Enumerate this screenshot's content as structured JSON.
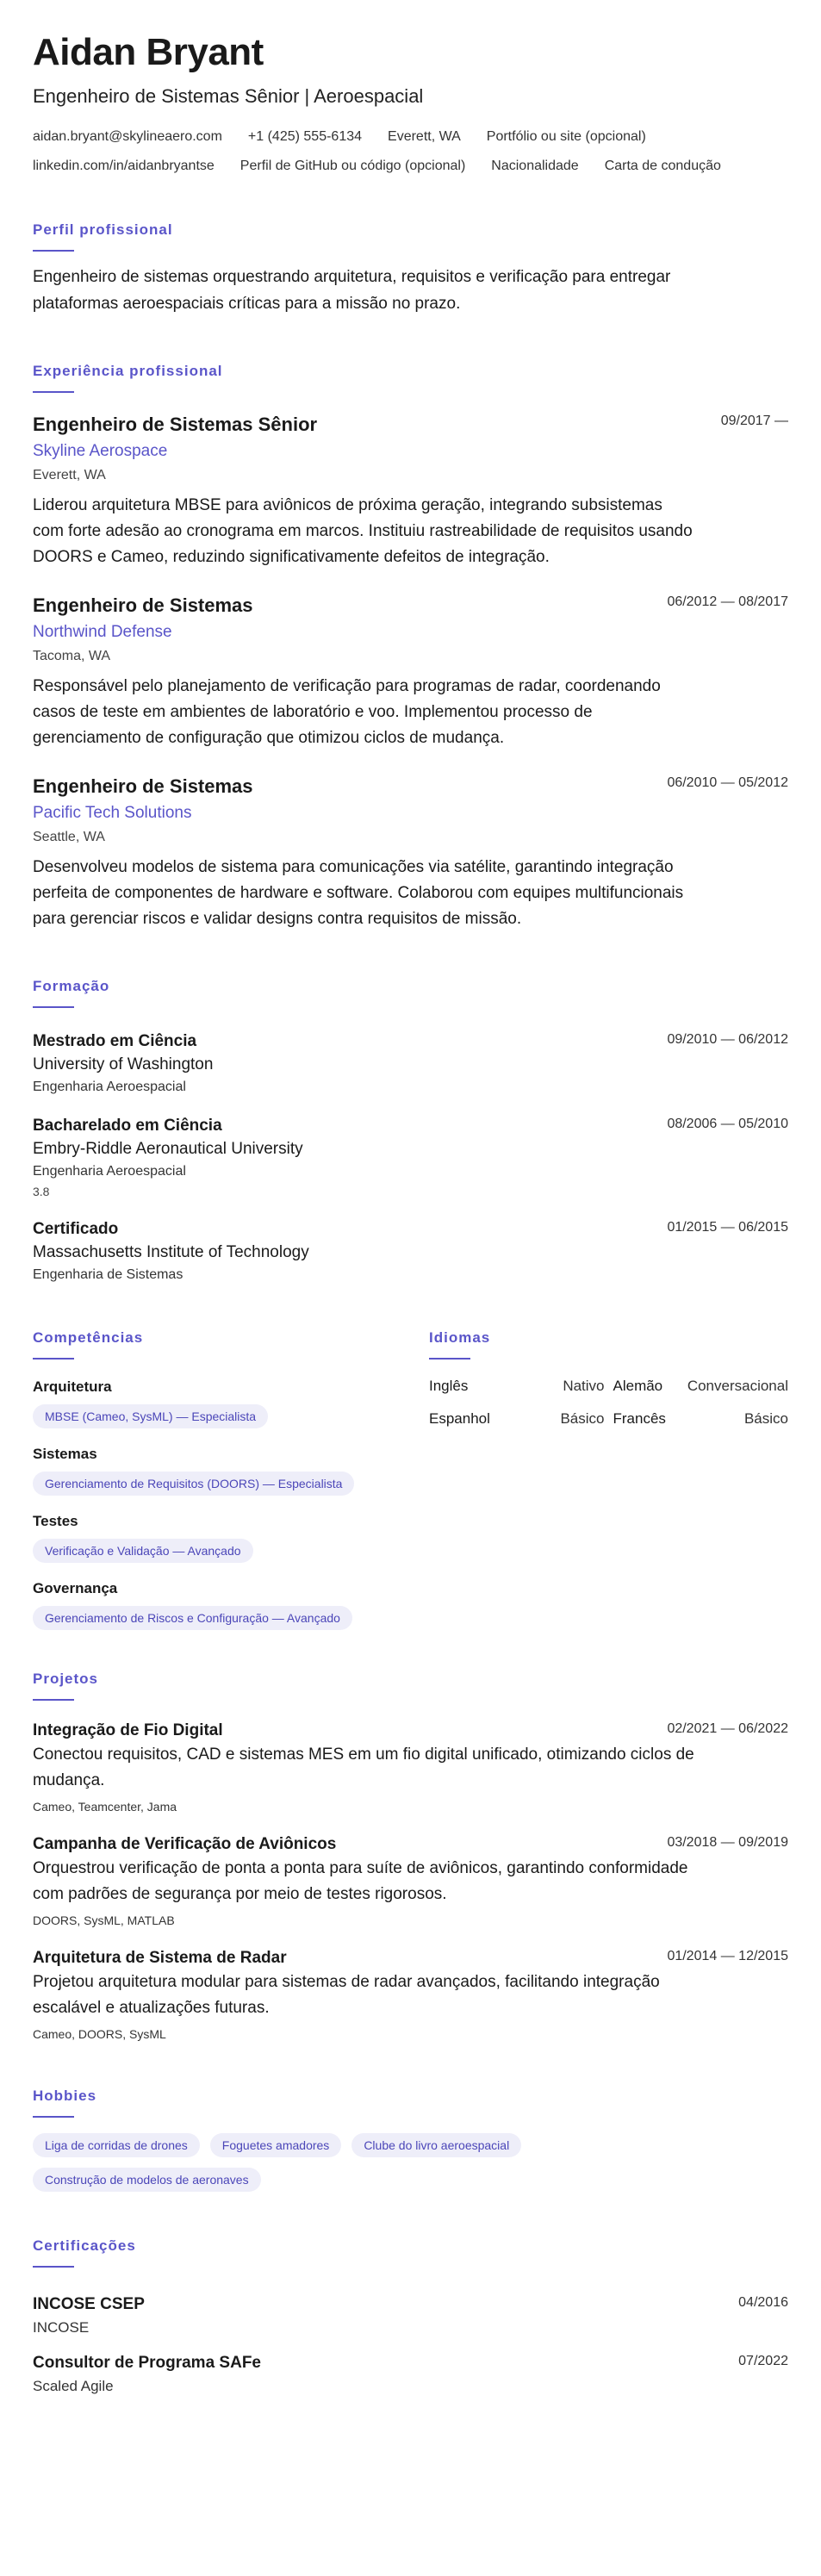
{
  "header": {
    "name": "Aidan Bryant",
    "title": "Engenheiro de Sistemas Sênior | Aeroespacial",
    "contacts": [
      "aidan.bryant@skylineaero.com",
      "+1 (425) 555-6134",
      "Everett, WA",
      "Portfólio ou site (opcional)",
      "linkedin.com/in/aidanbryantse",
      "Perfil de GitHub ou código (opcional)",
      "Nacionalidade",
      "Carta de condução"
    ]
  },
  "summary": {
    "heading": "Perfil profissional",
    "text": "Engenheiro de sistemas orquestrando arquitetura, requisitos e verificação para entregar plataformas aeroespaciais críticas para a missão no prazo."
  },
  "experience": {
    "heading": "Experiência profissional",
    "jobs": [
      {
        "title": "Engenheiro de Sistemas Sênior",
        "company": "Skyline Aerospace",
        "location": "Everett, WA",
        "dates": "09/2017 —",
        "description": "Liderou arquitetura MBSE para aviônicos de próxima geração, integrando subsistemas com forte adesão ao cronograma em marcos. Instituiu rastreabilidade de requisitos usando DOORS e Cameo, reduzindo significativamente defeitos de integração."
      },
      {
        "title": "Engenheiro de Sistemas",
        "company": "Northwind Defense",
        "location": "Tacoma, WA",
        "dates": "06/2012 — 08/2017",
        "description": "Responsável pelo planejamento de verificação para programas de radar, coordenando casos de teste em ambientes de laboratório e voo. Implementou processo de gerenciamento de configuração que otimizou ciclos de mudança."
      },
      {
        "title": "Engenheiro de Sistemas",
        "company": "Pacific Tech Solutions",
        "location": "Seattle, WA",
        "dates": "06/2010 — 05/2012",
        "description": "Desenvolveu modelos de sistema para comunicações via satélite, garantindo integração perfeita de componentes de hardware e software. Colaborou com equipes multifuncionais para gerenciar riscos e validar designs contra requisitos de missão."
      }
    ]
  },
  "education": {
    "heading": "Formação",
    "items": [
      {
        "degree": "Mestrado em Ciência",
        "school": "University of Washington",
        "field": "Engenharia Aeroespacial",
        "gpa": "",
        "dates": "09/2010 — 06/2012"
      },
      {
        "degree": "Bacharelado em Ciência",
        "school": "Embry-Riddle Aeronautical University",
        "field": "Engenharia Aeroespacial",
        "gpa": "3.8",
        "dates": "08/2006 — 05/2010"
      },
      {
        "degree": "Certificado",
        "school": "Massachusetts Institute of Technology",
        "field": "Engenharia de Sistemas",
        "gpa": "",
        "dates": "01/2015 — 06/2015"
      }
    ]
  },
  "skills": {
    "heading": "Competências",
    "categories": [
      {
        "name": "Arquitetura",
        "chip": "MBSE (Cameo, SysML) — Especialista"
      },
      {
        "name": "Sistemas",
        "chip": "Gerenciamento de Requisitos (DOORS) — Especialista"
      },
      {
        "name": "Testes",
        "chip": "Verificação e Validação — Avançado"
      },
      {
        "name": "Governança",
        "chip": "Gerenciamento de Riscos e Configuração — Avançado"
      }
    ]
  },
  "languages": {
    "heading": "Idiomas",
    "items": [
      {
        "name": "Inglês",
        "level": "Nativo"
      },
      {
        "name": "Alemão",
        "level": "Conversacional"
      },
      {
        "name": "Espanhol",
        "level": "Básico"
      },
      {
        "name": "Francês",
        "level": "Básico"
      }
    ]
  },
  "projects": {
    "heading": "Projetos",
    "items": [
      {
        "name": "Integração de Fio Digital",
        "dates": "02/2021 — 06/2022",
        "description": "Conectou requisitos, CAD e sistemas MES em um fio digital unificado, otimizando ciclos de mudança.",
        "tools": "Cameo, Teamcenter, Jama"
      },
      {
        "name": "Campanha de Verificação de Aviônicos",
        "dates": "03/2018 — 09/2019",
        "description": "Orquestrou verificação de ponta a ponta para suíte de aviônicos, garantindo conformidade com padrões de segurança por meio de testes rigorosos.",
        "tools": "DOORS, SysML, MATLAB"
      },
      {
        "name": "Arquitetura de Sistema de Radar",
        "dates": "01/2014 — 12/2015",
        "description": "Projetou arquitetura modular para sistemas de radar avançados, facilitando integração escalável e atualizações futuras.",
        "tools": "Cameo, DOORS, SysML"
      }
    ]
  },
  "hobbies": {
    "heading": "Hobbies",
    "items": [
      "Liga de corridas de drones",
      "Foguetes amadores",
      "Clube do livro aeroespacial",
      "Construção de modelos de aeronaves"
    ]
  },
  "certifications": {
    "heading": "Certificações",
    "items": [
      {
        "name": "INCOSE CSEP",
        "issuer": "INCOSE",
        "date": "04/2016"
      },
      {
        "name": "Consultor de Programa SAFe",
        "issuer": "Scaled Agile",
        "date": "07/2022"
      }
    ]
  },
  "colors": {
    "accent": "#5a55c9",
    "chip_bg": "#eeeef9",
    "chip_text": "#4b46b8"
  }
}
